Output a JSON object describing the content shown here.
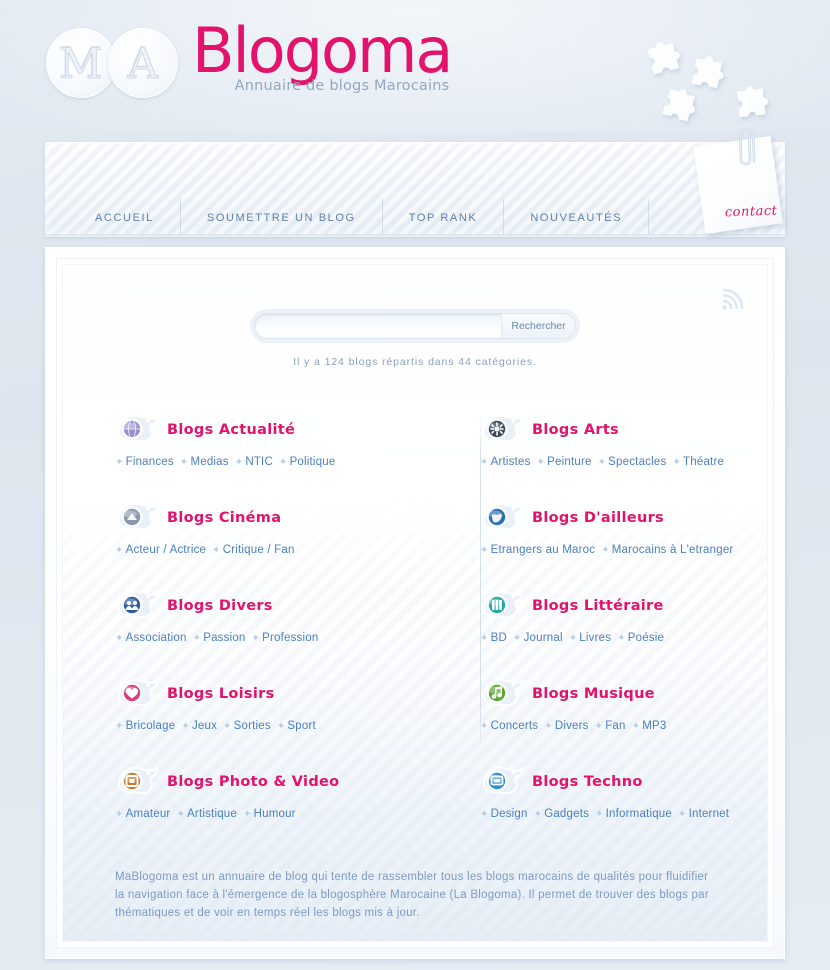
{
  "site": {
    "logo_initials": [
      "M",
      "A"
    ],
    "brand_name": "Blogoma",
    "tagline": "Annuaire de blogs Marocains"
  },
  "nav": {
    "items": [
      {
        "label": "ACCUEIL"
      },
      {
        "label": "SOUMETTRE UN BLOG"
      },
      {
        "label": "TOP RANK"
      },
      {
        "label": "NOUVEAUTÉS"
      }
    ],
    "contact_note_label": "contact"
  },
  "search": {
    "value": "",
    "placeholder": "",
    "button_label": "Rechercher"
  },
  "stats": {
    "text": "Il y a 124 blogs répartis dans 44 catégories.",
    "blog_count": 124,
    "category_count": 44
  },
  "colors": {
    "brand_pink": "#e3126b",
    "link_blue": "#4a7fc1",
    "nav_blue": "#5f7fa6",
    "muted_blue": "#8aa0ba",
    "page_bg": "#dee6ef"
  },
  "categories": {
    "left": [
      {
        "title": "Blogs Actualité",
        "icon": "globe-icon",
        "icon_color": "#9b8fd4",
        "subs": [
          "Finances",
          "Medias",
          "NTIC",
          "Politique"
        ]
      },
      {
        "title": "Blogs Cinéma",
        "icon": "film-icon",
        "icon_color": "#8a98ab",
        "subs": [
          "Acteur / Actrice",
          "Critique / Fan"
        ]
      },
      {
        "title": "Blogs Divers",
        "icon": "people-icon",
        "icon_color": "#2f5b9e",
        "subs": [
          "Association",
          "Passion",
          "Profession"
        ]
      },
      {
        "title": "Blogs Loisirs",
        "icon": "heart-icon",
        "icon_color": "#d4417e",
        "subs": [
          "Bricolage",
          "Jeux",
          "Sorties",
          "Sport"
        ]
      },
      {
        "title": "Blogs Photo & Video",
        "icon": "photo-icon",
        "icon_color": "#c97a2e",
        "subs": [
          "Amateur",
          "Artistique",
          "Humour"
        ]
      }
    ],
    "right": [
      {
        "title": "Blogs Arts",
        "icon": "palette-icon",
        "icon_color": "#3c4a5c",
        "subs": [
          "Artistes",
          "Peinture",
          "Spectacles",
          "Théatre"
        ]
      },
      {
        "title": "Blogs D'ailleurs",
        "icon": "world-icon",
        "icon_color": "#2b6fb5",
        "subs": [
          "Etrangers au Maroc",
          "Marocains à L'etranger"
        ]
      },
      {
        "title": "Blogs Littéraire",
        "icon": "books-icon",
        "icon_color": "#27a8a8",
        "subs": [
          "BD",
          "Journal",
          "Livres",
          "Poésie"
        ]
      },
      {
        "title": "Blogs Musique",
        "icon": "music-note-icon",
        "icon_color": "#5aa832",
        "subs": [
          "Concerts",
          "Divers",
          "Fan",
          "MP3"
        ]
      },
      {
        "title": "Blogs Techno",
        "icon": "screen-icon",
        "icon_color": "#2b8fd0",
        "subs": [
          "Design",
          "Gadgets",
          "Informatique",
          "Internet"
        ]
      }
    ]
  },
  "about": {
    "text": "MaBlogoma est un annuaire de blog qui tente de rassembler tous les blogs marocains de qualités pour fluidifier la navigation face à l'émergence de la blogosphère Marocaine (La Blogoma). Il permet de trouver des blogs par thématiques et de voir en temps réel les blogs mis à jour."
  },
  "icons": {
    "rss": "rss-feed-icon",
    "puzzle": "puzzle-piece-icon",
    "paperclip": "paperclip-icon",
    "bullet": "tick-bullet-icon"
  }
}
